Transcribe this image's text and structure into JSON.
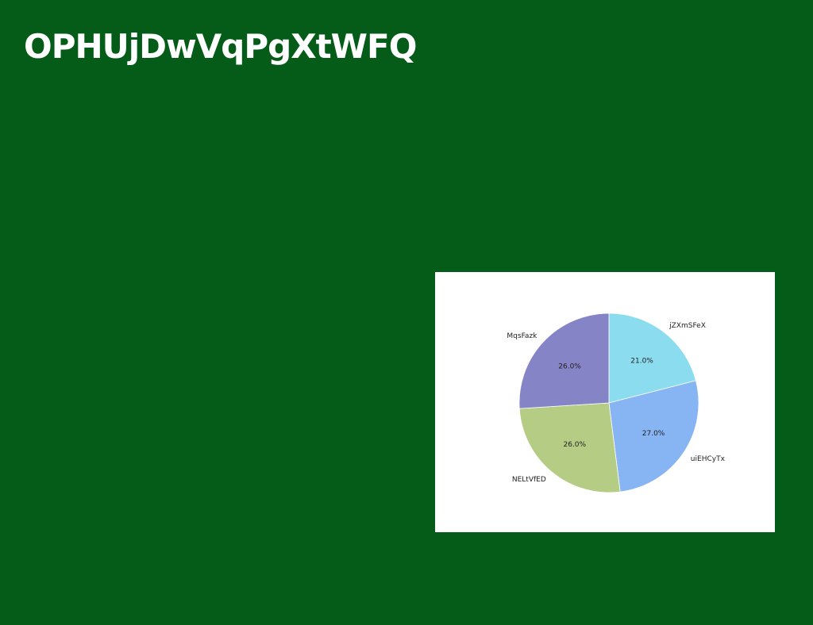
{
  "title": "OPHUjDwVqPgXtWFQ",
  "chart_data": {
    "type": "pie",
    "categories": [
      "jZXmSFeX",
      "uiEHCyTx",
      "NELtVfED",
      "MqsFazk"
    ],
    "values": [
      21.0,
      27.0,
      26.0,
      26.0
    ],
    "labels_pct": [
      "21.0%",
      "27.0%",
      "26.0%",
      "26.0%"
    ],
    "colors": [
      "#8cdcf0",
      "#87b4f2",
      "#b5cc85",
      "#8484c6"
    ],
    "start_angle": 90,
    "direction": "clockwise"
  }
}
